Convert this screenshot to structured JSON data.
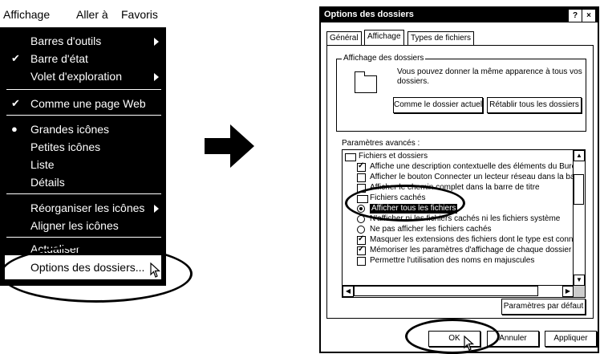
{
  "menubar": {
    "items": [
      "Affichage",
      "Aller à",
      "Favoris"
    ]
  },
  "menu": {
    "items": [
      {
        "label": "Barres d'outils",
        "submenu": true,
        "check": "",
        "group": 1
      },
      {
        "label": "Barre d'état",
        "submenu": false,
        "check": "✔",
        "group": 1
      },
      {
        "label": "Volet d'exploration",
        "submenu": true,
        "check": "",
        "group": 1
      },
      {
        "label": "Comme une page Web",
        "submenu": false,
        "check": "✔",
        "group": 2
      },
      {
        "label": "Grandes icônes",
        "submenu": false,
        "check": "●",
        "group": 3
      },
      {
        "label": "Petites icônes",
        "submenu": false,
        "check": "",
        "group": 3
      },
      {
        "label": "Liste",
        "submenu": false,
        "check": "",
        "group": 3
      },
      {
        "label": "Détails",
        "submenu": false,
        "check": "",
        "group": 3
      },
      {
        "label": "Réorganiser les icônes",
        "submenu": true,
        "check": "",
        "group": 4
      },
      {
        "label": "Aligner les icônes",
        "submenu": false,
        "check": "",
        "group": 4
      },
      {
        "label": "Actualiser",
        "submenu": false,
        "check": "",
        "group": 5
      },
      {
        "label": "Options des dossiers...",
        "submenu": false,
        "check": "",
        "group": 5
      }
    ]
  },
  "dialog": {
    "title": "Options des dossiers",
    "title_buttons": [
      "?",
      "×"
    ],
    "tabs": [
      "Général",
      "Affichage",
      "Types de fichiers"
    ],
    "active_tab": "Affichage",
    "group_label": "Affichage des dossiers",
    "note": "Vous pouvez donner la même apparence à tous vos dossiers.",
    "btn_current": "Comme le dossier actuel",
    "btn_reset_all": "Rétablir tous les dossiers",
    "advanced_label": "Paramètres avancés :",
    "list": [
      {
        "type": "folder",
        "text": "Fichiers et dossiers",
        "indent": 0
      },
      {
        "type": "check",
        "on": true,
        "text": "Affiche une description contextuelle des éléments du Bureau",
        "indent": 1
      },
      {
        "type": "check",
        "on": false,
        "text": "Afficher le bouton Connecter un lecteur réseau dans la barre",
        "indent": 1
      },
      {
        "type": "check",
        "on": false,
        "text": "Afficher le chemin complet dans la barre de titre",
        "indent": 1
      },
      {
        "type": "folder",
        "text": "Fichiers cachés",
        "indent": 1
      },
      {
        "type": "radio",
        "on": true,
        "text": "Afficher tous les fichiers",
        "indent": 2,
        "selected": true
      },
      {
        "type": "radio",
        "on": false,
        "text": "N'afficher ni les fichiers cachés ni les fichiers système",
        "indent": 2
      },
      {
        "type": "radio",
        "on": false,
        "text": "Ne pas afficher les fichiers cachés",
        "indent": 2
      },
      {
        "type": "check",
        "on": true,
        "text": "Masquer les extensions des fichiers dont le type est connu",
        "indent": 1
      },
      {
        "type": "check",
        "on": true,
        "text": "Mémoriser les paramètres d'affichage de chaque dossier",
        "indent": 1
      },
      {
        "type": "check",
        "on": false,
        "text": "Permettre l'utilisation des noms en majuscules",
        "indent": 1
      }
    ],
    "btn_defaults": "Paramètres par défaut",
    "btn_ok": "OK",
    "btn_cancel": "Annuler",
    "btn_apply": "Appliquer"
  }
}
